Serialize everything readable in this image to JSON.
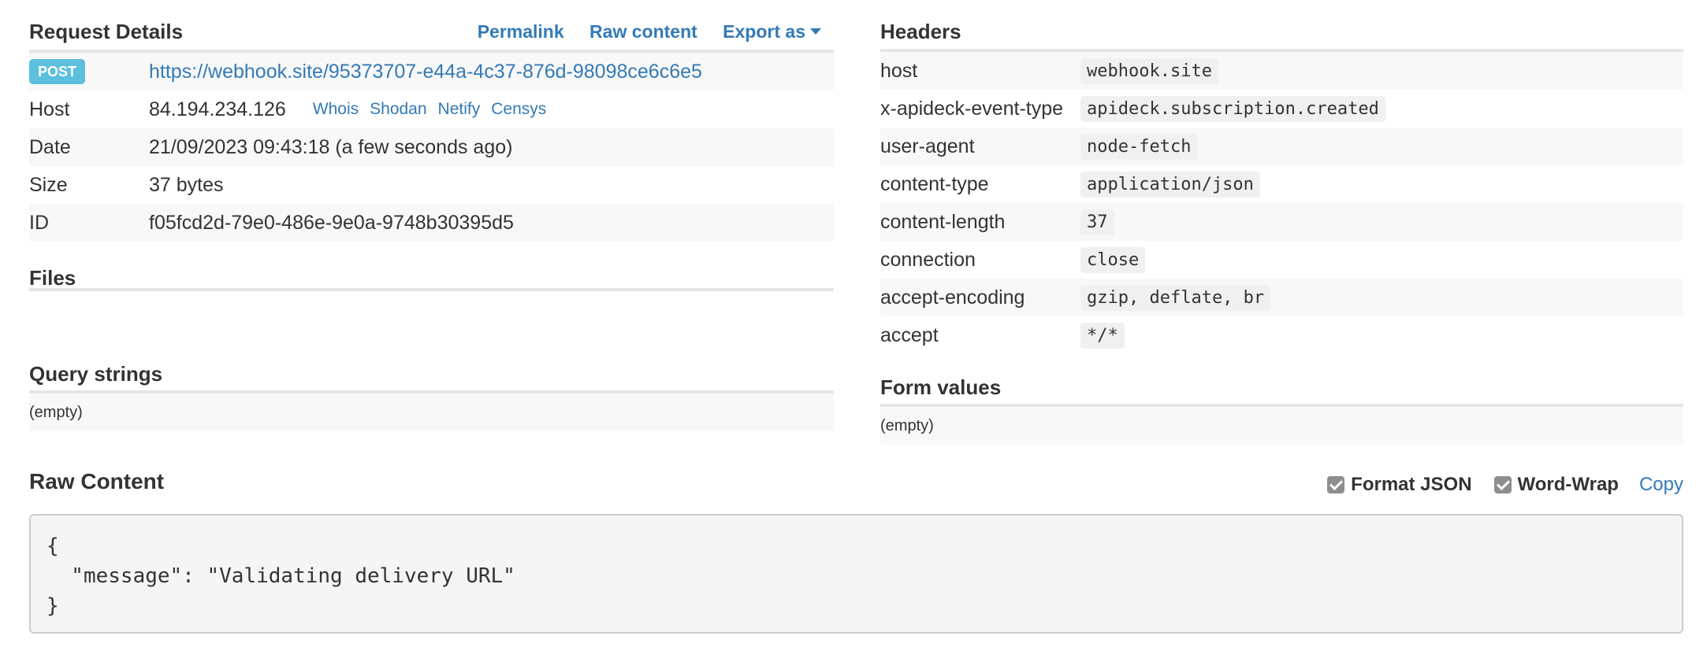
{
  "request_details": {
    "title": "Request Details",
    "actions": {
      "permalink": "Permalink",
      "raw_content": "Raw content",
      "export_as": "Export as"
    },
    "method": "POST",
    "url": "https://webhook.site/95373707-e44a-4c37-876d-98098ce6c6e5",
    "rows": [
      {
        "label": "Host",
        "value": "84.194.234.126"
      },
      {
        "label": "Date",
        "value": "21/09/2023 09:43:18 (a few seconds ago)"
      },
      {
        "label": "Size",
        "value": "37 bytes"
      },
      {
        "label": "ID",
        "value": "f05fcd2d-79e0-486e-9e0a-9748b30395d5"
      }
    ],
    "host_links": [
      "Whois",
      "Shodan",
      "Netify",
      "Censys"
    ]
  },
  "files": {
    "title": "Files"
  },
  "query_strings": {
    "title": "Query strings",
    "value": "(empty)"
  },
  "headers": {
    "title": "Headers",
    "rows": [
      {
        "name": "host",
        "value": "webhook.site"
      },
      {
        "name": "x-apideck-event-type",
        "value": "apideck.subscription.created"
      },
      {
        "name": "user-agent",
        "value": "node-fetch"
      },
      {
        "name": "content-type",
        "value": "application/json"
      },
      {
        "name": "content-length",
        "value": "37"
      },
      {
        "name": "connection",
        "value": "close"
      },
      {
        "name": "accept-encoding",
        "value": "gzip, deflate, br"
      },
      {
        "name": "accept",
        "value": "*/*"
      }
    ]
  },
  "form_values": {
    "title": "Form values",
    "value": "(empty)"
  },
  "raw_content": {
    "title": "Raw Content",
    "format_json": "Format JSON",
    "format_json_checked": true,
    "word_wrap": "Word-Wrap",
    "word_wrap_checked": true,
    "copy": "Copy",
    "body": "{\n  \"message\": \"Validating delivery URL\"\n}"
  },
  "colors": {
    "link": "#337ab7",
    "badge": "#5bc0de",
    "stripe": "#f8f8f8"
  }
}
